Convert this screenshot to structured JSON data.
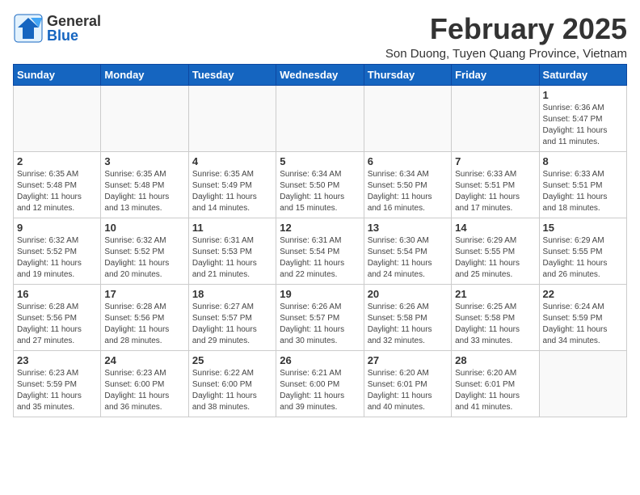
{
  "header": {
    "logo_general": "General",
    "logo_blue": "Blue",
    "month": "February 2025",
    "location": "Son Duong, Tuyen Quang Province, Vietnam"
  },
  "weekdays": [
    "Sunday",
    "Monday",
    "Tuesday",
    "Wednesday",
    "Thursday",
    "Friday",
    "Saturday"
  ],
  "weeks": [
    [
      {
        "day": "",
        "info": ""
      },
      {
        "day": "",
        "info": ""
      },
      {
        "day": "",
        "info": ""
      },
      {
        "day": "",
        "info": ""
      },
      {
        "day": "",
        "info": ""
      },
      {
        "day": "",
        "info": ""
      },
      {
        "day": "1",
        "info": "Sunrise: 6:36 AM\nSunset: 5:47 PM\nDaylight: 11 hours\nand 11 minutes."
      }
    ],
    [
      {
        "day": "2",
        "info": "Sunrise: 6:35 AM\nSunset: 5:48 PM\nDaylight: 11 hours\nand 12 minutes."
      },
      {
        "day": "3",
        "info": "Sunrise: 6:35 AM\nSunset: 5:48 PM\nDaylight: 11 hours\nand 13 minutes."
      },
      {
        "day": "4",
        "info": "Sunrise: 6:35 AM\nSunset: 5:49 PM\nDaylight: 11 hours\nand 14 minutes."
      },
      {
        "day": "5",
        "info": "Sunrise: 6:34 AM\nSunset: 5:50 PM\nDaylight: 11 hours\nand 15 minutes."
      },
      {
        "day": "6",
        "info": "Sunrise: 6:34 AM\nSunset: 5:50 PM\nDaylight: 11 hours\nand 16 minutes."
      },
      {
        "day": "7",
        "info": "Sunrise: 6:33 AM\nSunset: 5:51 PM\nDaylight: 11 hours\nand 17 minutes."
      },
      {
        "day": "8",
        "info": "Sunrise: 6:33 AM\nSunset: 5:51 PM\nDaylight: 11 hours\nand 18 minutes."
      }
    ],
    [
      {
        "day": "9",
        "info": "Sunrise: 6:32 AM\nSunset: 5:52 PM\nDaylight: 11 hours\nand 19 minutes."
      },
      {
        "day": "10",
        "info": "Sunrise: 6:32 AM\nSunset: 5:52 PM\nDaylight: 11 hours\nand 20 minutes."
      },
      {
        "day": "11",
        "info": "Sunrise: 6:31 AM\nSunset: 5:53 PM\nDaylight: 11 hours\nand 21 minutes."
      },
      {
        "day": "12",
        "info": "Sunrise: 6:31 AM\nSunset: 5:54 PM\nDaylight: 11 hours\nand 22 minutes."
      },
      {
        "day": "13",
        "info": "Sunrise: 6:30 AM\nSunset: 5:54 PM\nDaylight: 11 hours\nand 24 minutes."
      },
      {
        "day": "14",
        "info": "Sunrise: 6:29 AM\nSunset: 5:55 PM\nDaylight: 11 hours\nand 25 minutes."
      },
      {
        "day": "15",
        "info": "Sunrise: 6:29 AM\nSunset: 5:55 PM\nDaylight: 11 hours\nand 26 minutes."
      }
    ],
    [
      {
        "day": "16",
        "info": "Sunrise: 6:28 AM\nSunset: 5:56 PM\nDaylight: 11 hours\nand 27 minutes."
      },
      {
        "day": "17",
        "info": "Sunrise: 6:28 AM\nSunset: 5:56 PM\nDaylight: 11 hours\nand 28 minutes."
      },
      {
        "day": "18",
        "info": "Sunrise: 6:27 AM\nSunset: 5:57 PM\nDaylight: 11 hours\nand 29 minutes."
      },
      {
        "day": "19",
        "info": "Sunrise: 6:26 AM\nSunset: 5:57 PM\nDaylight: 11 hours\nand 30 minutes."
      },
      {
        "day": "20",
        "info": "Sunrise: 6:26 AM\nSunset: 5:58 PM\nDaylight: 11 hours\nand 32 minutes."
      },
      {
        "day": "21",
        "info": "Sunrise: 6:25 AM\nSunset: 5:58 PM\nDaylight: 11 hours\nand 33 minutes."
      },
      {
        "day": "22",
        "info": "Sunrise: 6:24 AM\nSunset: 5:59 PM\nDaylight: 11 hours\nand 34 minutes."
      }
    ],
    [
      {
        "day": "23",
        "info": "Sunrise: 6:23 AM\nSunset: 5:59 PM\nDaylight: 11 hours\nand 35 minutes."
      },
      {
        "day": "24",
        "info": "Sunrise: 6:23 AM\nSunset: 6:00 PM\nDaylight: 11 hours\nand 36 minutes."
      },
      {
        "day": "25",
        "info": "Sunrise: 6:22 AM\nSunset: 6:00 PM\nDaylight: 11 hours\nand 38 minutes."
      },
      {
        "day": "26",
        "info": "Sunrise: 6:21 AM\nSunset: 6:00 PM\nDaylight: 11 hours\nand 39 minutes."
      },
      {
        "day": "27",
        "info": "Sunrise: 6:20 AM\nSunset: 6:01 PM\nDaylight: 11 hours\nand 40 minutes."
      },
      {
        "day": "28",
        "info": "Sunrise: 6:20 AM\nSunset: 6:01 PM\nDaylight: 11 hours\nand 41 minutes."
      },
      {
        "day": "",
        "info": ""
      }
    ]
  ]
}
